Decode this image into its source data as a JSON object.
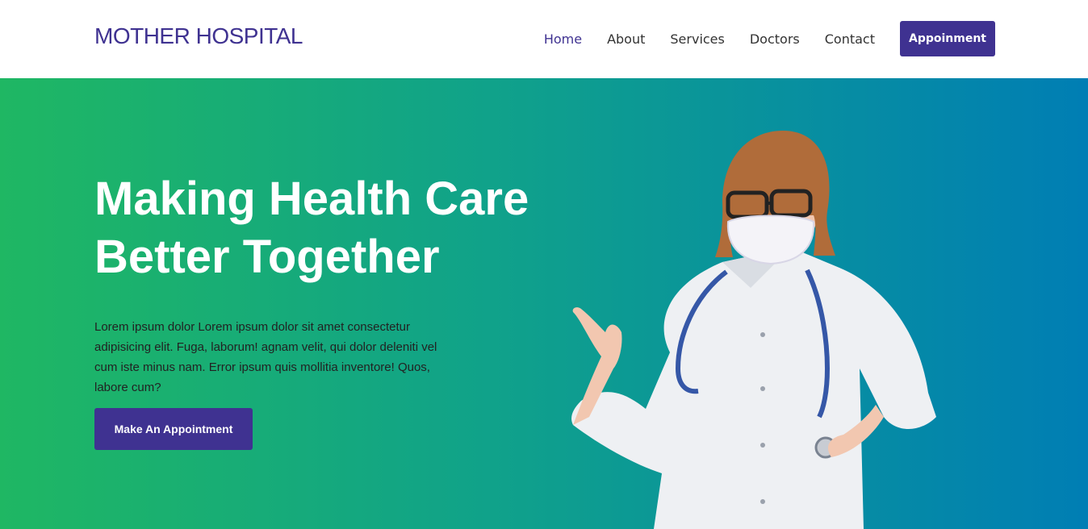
{
  "brand": "MOTHER HOSPITAL",
  "nav": {
    "items": [
      "Home",
      "About",
      "Services",
      "Doctors",
      "Contact"
    ],
    "cta": "Appoinment"
  },
  "hero": {
    "headline_line1": "Making Health Care",
    "headline_line2": "Better Together",
    "description": "Lorem ipsum dolor Lorem ipsum dolor sit amet consectetur adipisicing elit. Fuga, laborum! agnam velit, qui dolor deleniti vel cum iste minus nam. Error ipsum quis mollitia inventore! Quos, labore cum?",
    "button": "Make An Appointment"
  },
  "colors": {
    "brand": "#3f3291",
    "gradient_start": "#1fb763",
    "gradient_end": "#007eb4"
  }
}
